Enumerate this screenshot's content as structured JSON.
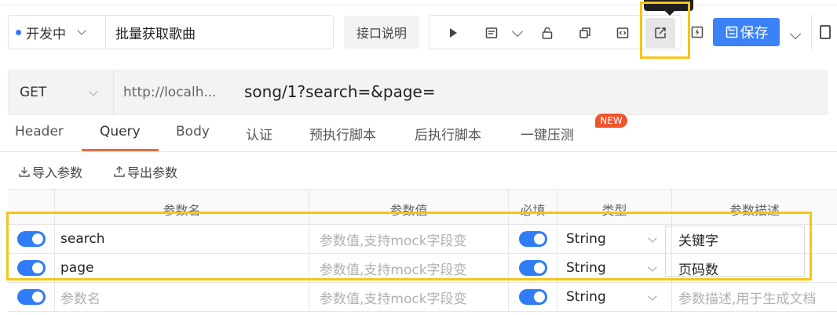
{
  "toolbar": {
    "status_label": "开发中",
    "api_name": "批量获取歌曲",
    "doc_button": "接口说明",
    "save_label": "保存",
    "icons": [
      "play-icon",
      "document-icon",
      "unlock-icon",
      "copy-icon",
      "code-icon",
      "share-icon",
      "bolt-icon"
    ]
  },
  "request": {
    "method": "GET",
    "base_url": "http://localh...",
    "path": "song/1?search=&page="
  },
  "tabs": [
    {
      "label": "Header"
    },
    {
      "label": "Query"
    },
    {
      "label": "Body"
    },
    {
      "label": "认证"
    },
    {
      "label": "预执行脚本"
    },
    {
      "label": "后执行脚本"
    },
    {
      "label": "一键压测"
    }
  ],
  "new_badge": "NEW",
  "actions": {
    "import": "导入参数",
    "export": "导出参数"
  },
  "table": {
    "headers": [
      "参数名",
      "参数值",
      "必填",
      "类型",
      "参数描述"
    ],
    "rows": [
      {
        "name": "search",
        "value_placeholder": "参数值,支持mock字段变",
        "type": "String",
        "description": "关键字"
      },
      {
        "name": "page",
        "value_placeholder": "参数值,支持mock字段变",
        "type": "String",
        "description": "页码数"
      }
    ],
    "empty_row": {
      "name_placeholder": "参数名",
      "value_placeholder": "参数值,支持mock字段变",
      "type": "String",
      "description_placeholder": "参数描述,用于生成文档"
    }
  },
  "colors": {
    "accent": "#3b82f6",
    "tab_active": "#f06a3a",
    "highlight": "#f5c518"
  }
}
